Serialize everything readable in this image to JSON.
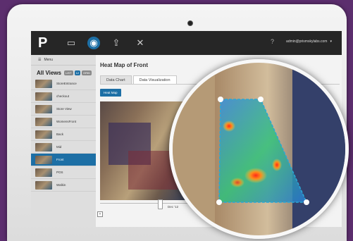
{
  "app": {
    "logo": "P",
    "user_email": "admin@prismskylabs.com"
  },
  "sidebar": {
    "menu_label": "Menu",
    "views_title": "All Views",
    "badges": [
      "LIST",
      "12",
      "GRID"
    ],
    "views": [
      {
        "label": "StoreEntrance",
        "selected": false
      },
      {
        "label": "checkout",
        "selected": false
      },
      {
        "label": "Store View",
        "selected": false
      },
      {
        "label": "WomensFront",
        "selected": false
      },
      {
        "label": "Back",
        "selected": false
      },
      {
        "label": "Mid",
        "selected": false
      },
      {
        "label": "Front",
        "selected": true
      },
      {
        "label": "POS",
        "selected": false
      },
      {
        "label": "Walkin",
        "selected": false
      }
    ]
  },
  "main": {
    "title": "Heat Map of Front",
    "tabs": [
      {
        "label": "Data Chart",
        "active": false
      },
      {
        "label": "Data Visualization",
        "active": true
      }
    ],
    "heatmap_button": "Heat Map",
    "timeline_label": "Dec '12",
    "zoom_label": "+"
  },
  "icons": {
    "display": "monitor-icon",
    "heatmap": "globe-icon",
    "share": "share-icon",
    "tools": "tools-icon",
    "help": "help-icon",
    "user": "user-icon",
    "chevron": "chevron-down-icon",
    "menu": "hamburger-icon"
  },
  "colors": {
    "accent": "#1d6fa5",
    "frame": "#5c2e6e",
    "heat_outline": "#2aa7d6"
  }
}
